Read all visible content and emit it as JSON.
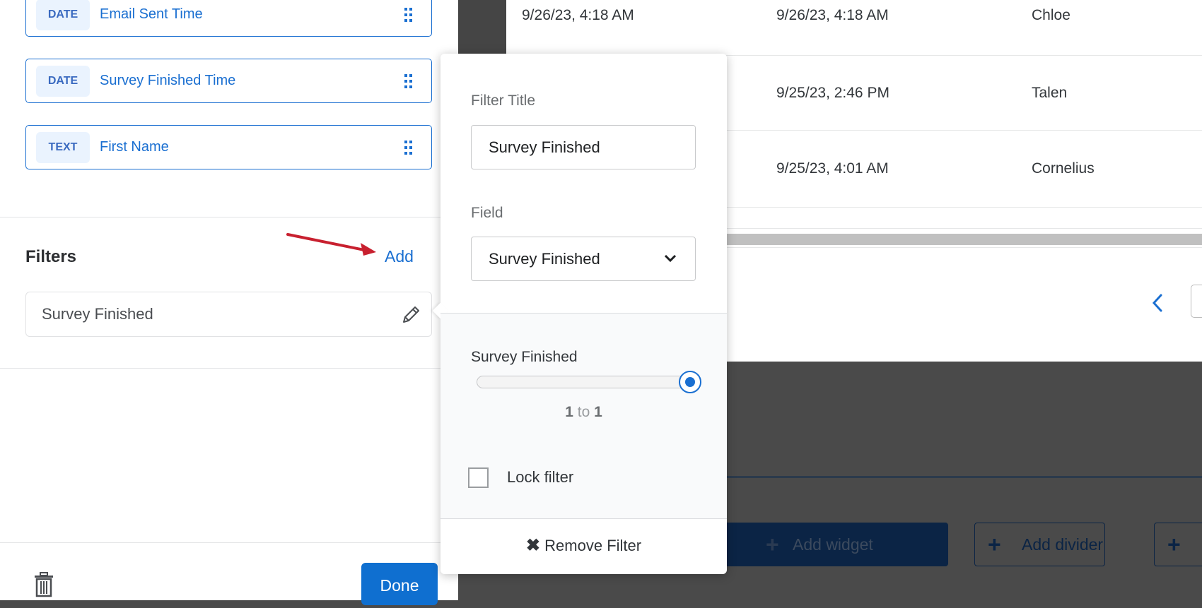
{
  "fields": [
    {
      "type": "DATE",
      "name": "Email Sent Time"
    },
    {
      "type": "DATE",
      "name": "Survey Finished Time"
    },
    {
      "type": "TEXT",
      "name": "First Name"
    }
  ],
  "filters": {
    "heading": "Filters",
    "add_label": "Add",
    "items": [
      {
        "label": "Survey Finished"
      }
    ]
  },
  "footer": {
    "done_label": "Done"
  },
  "table": {
    "rows": [
      [
        "9/26/23, 4:18 AM",
        "9/26/23, 4:18 AM",
        "Chloe"
      ],
      [
        "",
        "9/25/23, 2:46 PM",
        "Talen"
      ],
      [
        "",
        "9/25/23, 4:01 AM",
        "Cornelius"
      ]
    ]
  },
  "popover": {
    "filter_title_label": "Filter Title",
    "filter_title_value": "Survey Finished",
    "field_label": "Field",
    "field_value": "Survey Finished",
    "slider_label": "Survey Finished",
    "slider_min": "1",
    "slider_to": "to",
    "slider_max": "1",
    "slider_fraction": 1,
    "lock_label": "Lock filter",
    "lock_checked": false,
    "remove_label": "Remove Filter"
  },
  "dashboard": {
    "add_widget": "Add widget",
    "add_divider": "Add divider"
  },
  "colors": {
    "accent": "#1a6fd1",
    "annotation_arrow": "#c8202f"
  }
}
